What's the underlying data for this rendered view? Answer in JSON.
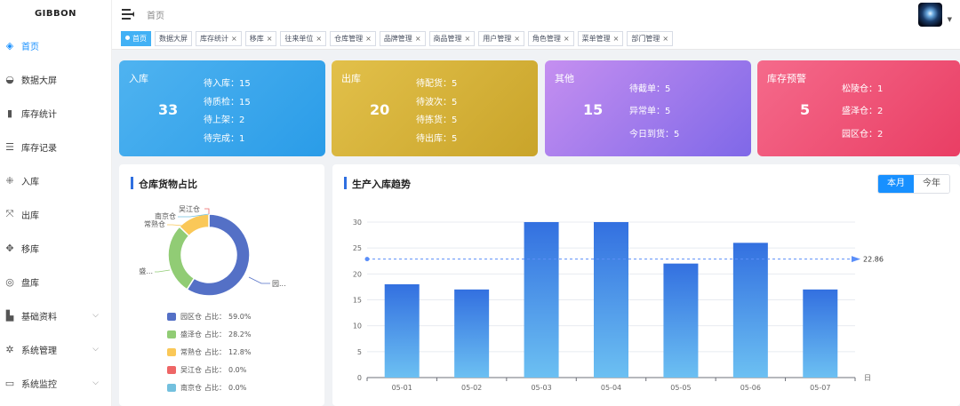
{
  "app": {
    "logo": "GIBBON"
  },
  "sidebar": {
    "items": [
      {
        "label": "首页",
        "icon": "dashboard-icon",
        "glyph": "◈",
        "active": true
      },
      {
        "label": "数据大屏",
        "icon": "gauge-icon",
        "glyph": "◒"
      },
      {
        "label": "库存统计",
        "icon": "bar-chart-icon",
        "glyph": "▮"
      },
      {
        "label": "库存记录",
        "icon": "list-icon",
        "glyph": "☰"
      },
      {
        "label": "入库",
        "icon": "compress-icon",
        "glyph": "⁜"
      },
      {
        "label": "出库",
        "icon": "expand-icon",
        "glyph": "⤧"
      },
      {
        "label": "移库",
        "icon": "move-icon",
        "glyph": "✥"
      },
      {
        "label": "盘库",
        "icon": "target-icon",
        "glyph": "◎"
      },
      {
        "label": "基础资料",
        "icon": "book-icon",
        "glyph": "▙",
        "expandable": true
      },
      {
        "label": "系统管理",
        "icon": "gear-icon",
        "glyph": "✲",
        "expandable": true
      },
      {
        "label": "系统监控",
        "icon": "monitor-icon",
        "glyph": "▭",
        "expandable": true
      }
    ]
  },
  "header": {
    "breadcrumb": "首页"
  },
  "tags": [
    {
      "label": "首页",
      "active": true
    },
    {
      "label": "数据大屏",
      "closable": false
    },
    {
      "label": "库存统计",
      "closable": true
    },
    {
      "label": "移库",
      "closable": true
    },
    {
      "label": "往来单位",
      "closable": true
    },
    {
      "label": "仓库管理",
      "closable": true
    },
    {
      "label": "品牌管理",
      "closable": true
    },
    {
      "label": "商品管理",
      "closable": true
    },
    {
      "label": "用户管理",
      "closable": true
    },
    {
      "label": "角色管理",
      "closable": true
    },
    {
      "label": "菜单管理",
      "closable": true
    },
    {
      "label": "部门管理",
      "closable": true
    }
  ],
  "cards": {
    "inbound": {
      "title": "入库",
      "total": "33",
      "lines": [
        "待入库：15",
        "待质检：15",
        "待上架：2",
        "待完成：1"
      ]
    },
    "outbound": {
      "title": "出库",
      "total": "20",
      "lines": [
        "待配货：5",
        "待波次：5",
        "待拣货：5",
        "待出库：5"
      ]
    },
    "other": {
      "title": "其他",
      "total": "15",
      "lines": [
        "待截单：5",
        "异常单：5",
        "今日到货：5"
      ]
    },
    "alert": {
      "title": "库存预警",
      "total": "5",
      "lines": [
        "松陵仓：1",
        "盛泽仓：2",
        "园区仓：2"
      ]
    }
  },
  "pie_panel": {
    "title": "仓库货物占比",
    "pct_label": "占比："
  },
  "bar_panel": {
    "title": "生产入库趋势",
    "toggle_month": "本月",
    "toggle_year": "今年"
  },
  "colors": {
    "primary": "#1890ff",
    "bar": "#3a7de3"
  },
  "chart_data": [
    {
      "type": "pie",
      "donut": true,
      "categories": [
        "园区仓",
        "盛泽仓",
        "常熟仓",
        "吴江仓",
        "南京仓"
      ],
      "values": [
        59.0,
        28.2,
        12.8,
        0.0,
        0.0
      ],
      "value_labels": [
        "59.0%",
        "28.2%",
        "12.8%",
        "0.0%",
        "0.0%"
      ],
      "slice_labels": [
        "园...",
        "盛...",
        "常熟仓",
        "吴江仓",
        "南京仓"
      ],
      "colors": [
        "#5470c6",
        "#91cc75",
        "#fac858",
        "#ee6666",
        "#73c0de"
      ],
      "legend": "bottom"
    },
    {
      "type": "bar",
      "categories": [
        "05-01",
        "05-02",
        "05-03",
        "05-04",
        "05-05",
        "05-06",
        "05-07"
      ],
      "values": [
        18,
        17,
        30,
        30,
        22,
        26,
        17
      ],
      "xlabel": "日",
      "ylim": [
        0,
        30
      ],
      "yticks": [
        0,
        5,
        10,
        15,
        20,
        25,
        30
      ],
      "average": 22.86,
      "average_label": "22.86",
      "grid": true
    }
  ]
}
